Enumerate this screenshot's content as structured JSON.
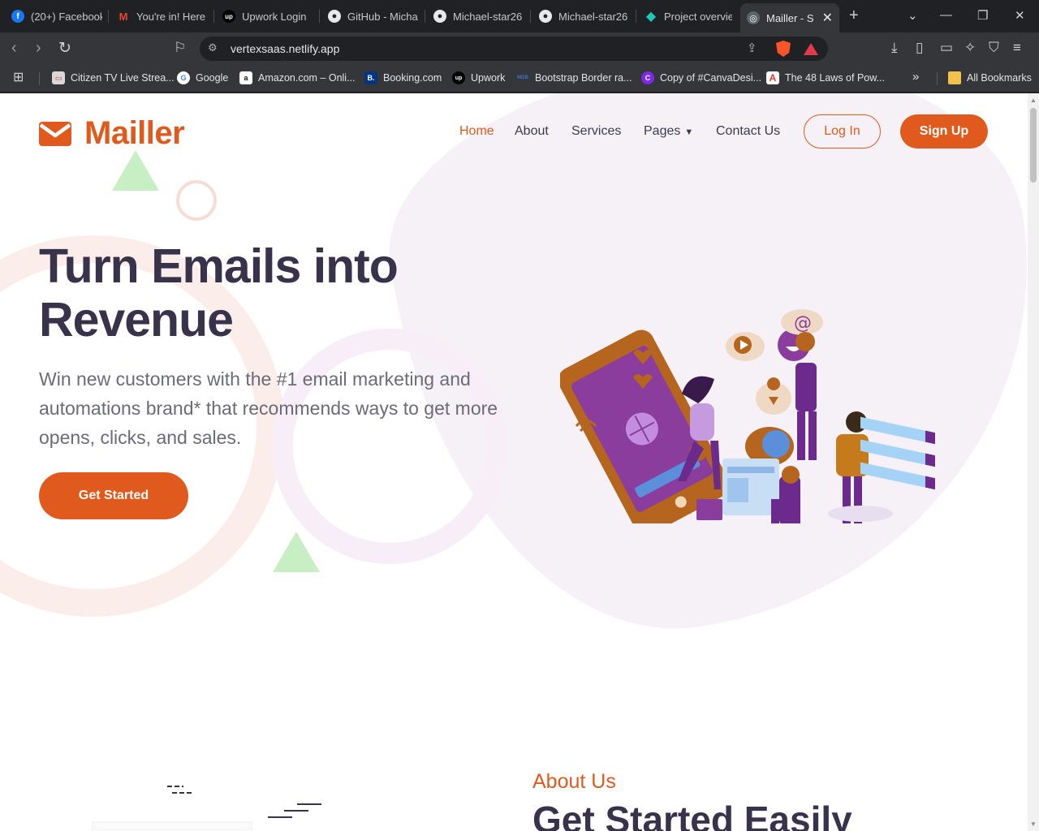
{
  "browser": {
    "tabs": [
      {
        "title": "(20+) Facebook",
        "icon": "facebook-icon",
        "color": "#1877f2",
        "glyph": "f"
      },
      {
        "title": "You're in! Here",
        "icon": "gmail-icon",
        "color": "#ea4335",
        "glyph": "M"
      },
      {
        "title": "Upwork Login",
        "icon": "upwork-icon",
        "color": "#111111",
        "glyph": "up"
      },
      {
        "title": "GitHub - Micha",
        "icon": "github-icon",
        "color": "#202124",
        "glyph": "●"
      },
      {
        "title": "Michael-star26",
        "icon": "github-icon",
        "color": "#202124",
        "glyph": "●"
      },
      {
        "title": "Michael-star26",
        "icon": "github-icon",
        "color": "#202124",
        "glyph": "●"
      },
      {
        "title": "Project overvie",
        "icon": "netlify-icon",
        "color": "#20c6b7",
        "glyph": "◆"
      },
      {
        "title": "Mailler - S",
        "icon": "globe-icon",
        "color": "#5f6368",
        "glyph": "◎"
      }
    ],
    "new_tab": "+",
    "url": "vertexsaas.netlify.app",
    "bookmarks": [
      {
        "label": "Citizen TV Live Strea...",
        "icon": "citizen-tv-icon",
        "color": "#d9d9d9",
        "glyph": "▭"
      },
      {
        "label": "Google",
        "icon": "google-icon",
        "color": "#ffffff",
        "glyph": "G"
      },
      {
        "label": "Amazon.com – Onli...",
        "icon": "amazon-icon",
        "color": "#ffffff",
        "glyph": "a"
      },
      {
        "label": "Booking.com",
        "icon": "booking-icon",
        "color": "#003580",
        "glyph": "B."
      },
      {
        "label": "Upwork",
        "icon": "upwork-icon",
        "color": "#111111",
        "glyph": "up"
      },
      {
        "label": "Bootstrap Border ra...",
        "icon": "mdb-icon",
        "color": "#3b71ca",
        "glyph": "MDB"
      },
      {
        "label": "Copy of #CanvaDesi...",
        "icon": "canva-icon",
        "color": "#7d2ae8",
        "glyph": "C"
      },
      {
        "label": "The 48 Laws of Pow...",
        "icon": "pdf-icon",
        "color": "#e53935",
        "glyph": "A"
      }
    ],
    "more_bookmarks": "»",
    "all_bookmarks": "All Bookmarks"
  },
  "site": {
    "brand": "Mailler",
    "nav": [
      {
        "label": "Home",
        "active": true
      },
      {
        "label": "About",
        "active": false
      },
      {
        "label": "Services",
        "active": false
      },
      {
        "label": "Pages",
        "active": false,
        "dropdown": true
      },
      {
        "label": "Contact Us",
        "active": false
      }
    ],
    "login_label": "Log In",
    "signup_label": "Sign Up",
    "hero": {
      "title": "Turn Emails into Revenue",
      "subtitle": "Win new customers with the #1 email marketing and automations brand* that recommends ways to get more opens, clicks, and sales.",
      "cta_label": "Get Started"
    },
    "about": {
      "label": "About Us",
      "title": "Get Started Easily"
    },
    "colors": {
      "accent": "#e05a1e",
      "heading": "#38334a",
      "body": "#6b6b78",
      "blob": "#f6f1f6"
    }
  }
}
